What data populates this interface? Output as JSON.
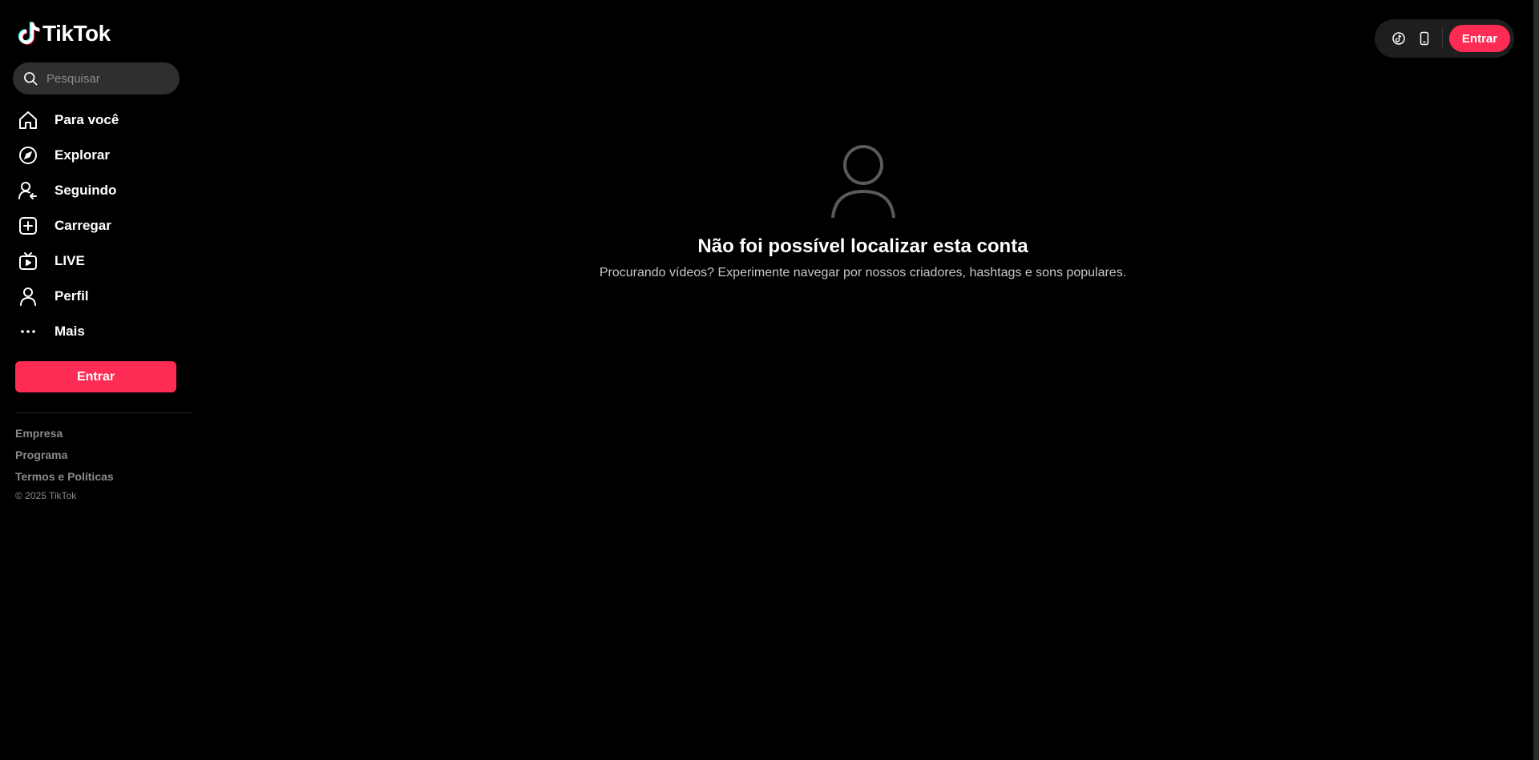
{
  "brand": {
    "logo_text": "TikTok",
    "logo_icon": "tiktok-note-icon"
  },
  "search": {
    "placeholder": "Pesquisar",
    "icon": "search-icon"
  },
  "sidebar": {
    "items": [
      {
        "label": "Para você",
        "icon": "home-icon"
      },
      {
        "label": "Explorar",
        "icon": "compass-icon"
      },
      {
        "label": "Seguindo",
        "icon": "following-icon"
      },
      {
        "label": "Carregar",
        "icon": "upload-icon"
      },
      {
        "label": "LIVE",
        "icon": "live-tv-icon"
      },
      {
        "label": "Perfil",
        "icon": "profile-icon"
      },
      {
        "label": "Mais",
        "icon": "more-icon"
      }
    ],
    "login_label": "Entrar",
    "footer": {
      "links": [
        "Empresa",
        "Programa",
        "Termos e Políticas"
      ],
      "copyright": "© 2025 TikTok"
    }
  },
  "topbar": {
    "icons": [
      "tiktok-coin-icon",
      "mobile-app-icon"
    ],
    "login_label": "Entrar"
  },
  "main": {
    "empty_state": {
      "icon": "user-outline-icon",
      "title": "Não foi possível localizar esta conta",
      "subtitle": "Procurando vídeos? Experimente navegar por nossos criadores, hashtags e sons populares."
    }
  },
  "colors": {
    "background": "#000000",
    "accent": "#fe2c55",
    "search_bg": "#2f2f2f",
    "muted_text": "#8a8a8a"
  }
}
